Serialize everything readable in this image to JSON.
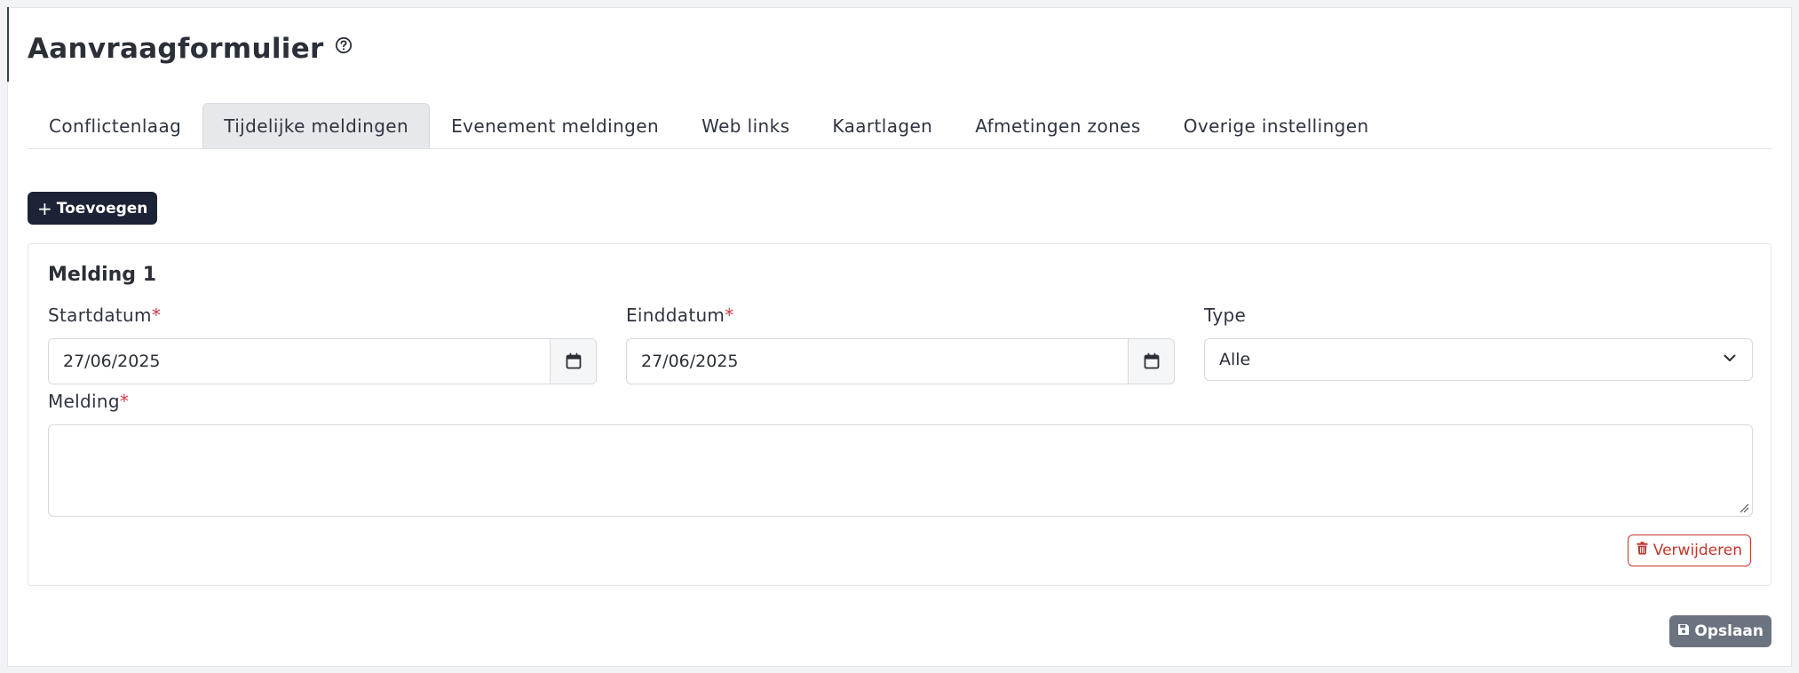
{
  "header": {
    "title": "Aanvraagformulier",
    "help_icon": "question-circle-icon"
  },
  "tabs": [
    {
      "label": "Conflictenlaag",
      "active": false
    },
    {
      "label": "Tijdelijke meldingen",
      "active": true
    },
    {
      "label": "Evenement meldingen",
      "active": false
    },
    {
      "label": "Web links",
      "active": false
    },
    {
      "label": "Kaartlagen",
      "active": false
    },
    {
      "label": "Afmetingen zones",
      "active": false
    },
    {
      "label": "Overige instellingen",
      "active": false
    }
  ],
  "add_button": {
    "label": "Toevoegen",
    "icon": "plus-icon"
  },
  "melding": {
    "title": "Melding 1",
    "startdatum": {
      "label": "Startdatum",
      "required_mark": "*",
      "value": "27/06/2025",
      "icon": "calendar-icon"
    },
    "einddatum": {
      "label": "Einddatum",
      "required_mark": "*",
      "value": "27/06/2025",
      "icon": "calendar-icon"
    },
    "type": {
      "label": "Type",
      "value": "Alle",
      "icon": "chevron-down-icon"
    },
    "melding_field": {
      "label": "Melding",
      "required_mark": "*",
      "value": ""
    },
    "delete_button": {
      "label": "Verwijderen",
      "icon": "trash-icon"
    }
  },
  "save_button": {
    "label": "Opslaan",
    "icon": "floppy-disk-icon"
  },
  "colors": {
    "primary_dark": "#1d2336",
    "danger": "#c0392b",
    "required": "#dc3545",
    "secondary": "#6c7380",
    "tab_active_bg": "#e6e8eb"
  }
}
